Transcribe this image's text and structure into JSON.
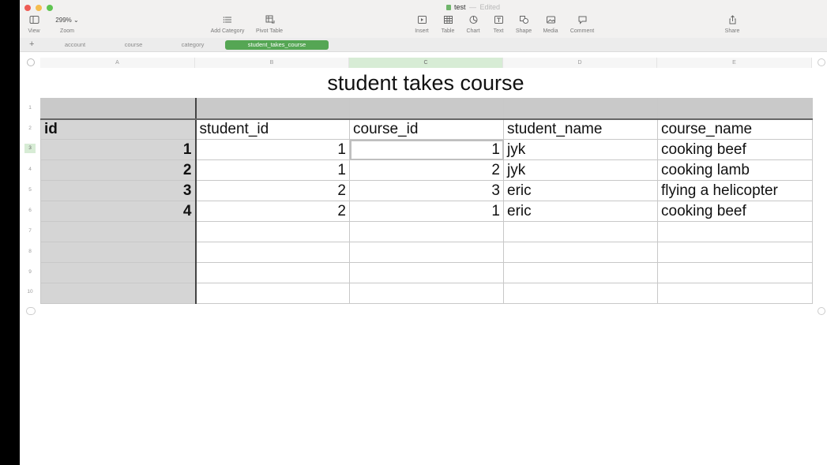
{
  "window": {
    "doc_name": "test",
    "separator": "—",
    "status": "Edited"
  },
  "toolbar": {
    "view": "View",
    "zoom_value": "299%",
    "zoom": "Zoom",
    "add_category": "Add Category",
    "pivot_table": "Pivot Table",
    "insert": "Insert",
    "table": "Table",
    "chart": "Chart",
    "text": "Text",
    "shape": "Shape",
    "media": "Media",
    "comment": "Comment",
    "share": "Share"
  },
  "sheets": {
    "add": "+",
    "tabs": [
      "account",
      "course",
      "category",
      "student_takes_course"
    ],
    "active_index": 3
  },
  "columns": [
    "A",
    "B",
    "C",
    "D",
    "E"
  ],
  "rows": [
    "1",
    "2",
    "3",
    "4",
    "5",
    "6",
    "7",
    "8",
    "9",
    "10"
  ],
  "table": {
    "title": "student takes course",
    "headers": [
      "id",
      "student_id",
      "course_id",
      "student_name",
      "course_name"
    ],
    "data": [
      [
        "1",
        "1",
        "1",
        "jyk",
        "cooking beef"
      ],
      [
        "2",
        "1",
        "2",
        "jyk",
        "cooking lamb"
      ],
      [
        "3",
        "2",
        "3",
        "eric",
        "flying a helicopter"
      ],
      [
        "4",
        "2",
        "1",
        "eric",
        "cooking beef"
      ]
    ]
  }
}
